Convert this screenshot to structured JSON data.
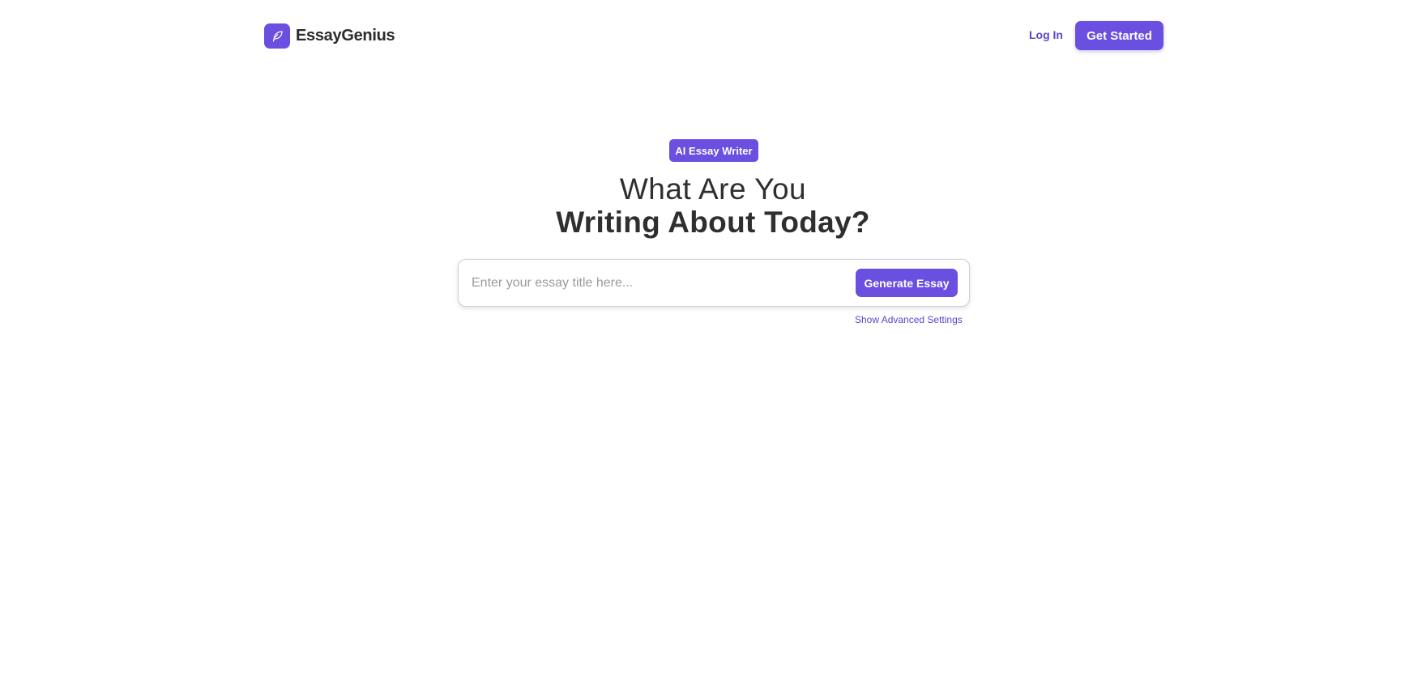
{
  "header": {
    "brand_name": "EssayGenius",
    "logo_icon": "feather-icon",
    "login_label": "Log In",
    "get_started_label": "Get Started"
  },
  "hero": {
    "badge": "AI Essay Writer",
    "headline_line1": "What Are You",
    "headline_line2": "Writing About Today?"
  },
  "search": {
    "placeholder": "Enter your essay title here...",
    "value": "",
    "generate_label": "Generate Essay",
    "advanced_settings_label": "Show Advanced Settings"
  },
  "colors": {
    "accent": "#6a4fe0",
    "link": "#5a47c9",
    "text": "#2f2f2f",
    "background": "#ffffff"
  }
}
